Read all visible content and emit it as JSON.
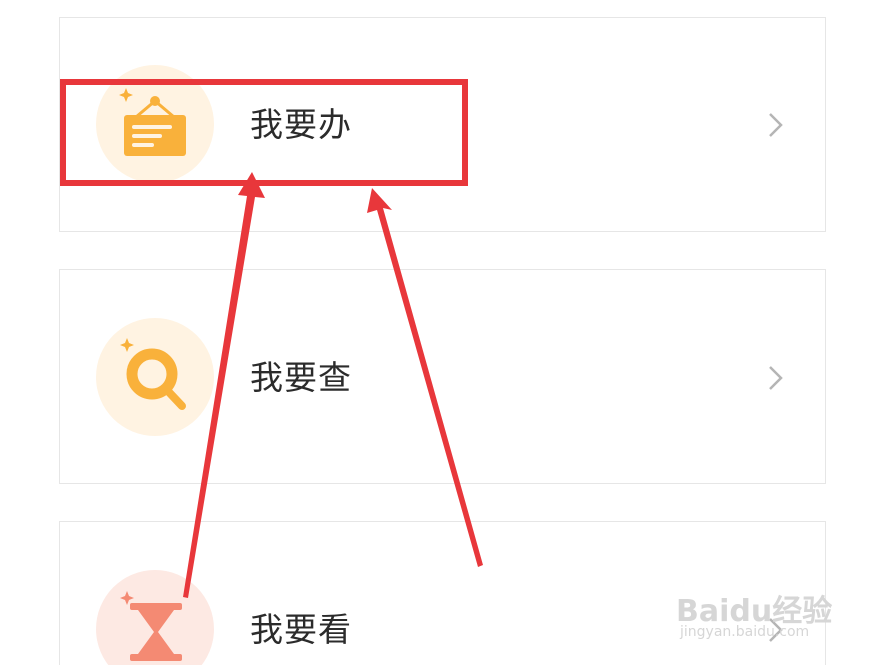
{
  "menu": {
    "items": [
      {
        "label": "我要办",
        "icon": "notice-board-icon"
      },
      {
        "label": "我要查",
        "icon": "magnifier-icon"
      },
      {
        "label": "我要看",
        "icon": "hourglass-icon"
      }
    ]
  },
  "colors": {
    "icon_bg_orange": "#fff3e2",
    "icon_bg_pink": "#fde9e3",
    "icon_orange": "#f9b13b",
    "icon_salmon": "#f48a73",
    "annotation_red": "#e8373b",
    "chevron_gray": "#b5b5b5"
  },
  "watermark": {
    "logo": "Baidu经验",
    "url": "jingyan.baidu.com"
  }
}
